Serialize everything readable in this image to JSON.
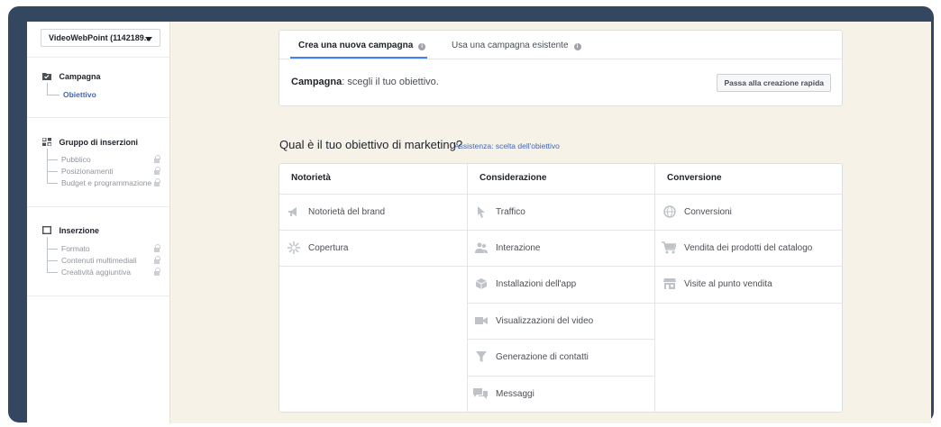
{
  "sidebar": {
    "account_label": "VideoWebPoint (1142189...",
    "sections": [
      {
        "title": "Campagna",
        "icon": "folder-check-icon",
        "items": [
          {
            "label": "Obiettivo",
            "active": true,
            "locked": false
          }
        ]
      },
      {
        "title": "Gruppo di inserzioni",
        "icon": "grid-icon",
        "items": [
          {
            "label": "Pubblico",
            "locked": true
          },
          {
            "label": "Posizionamenti",
            "locked": true
          },
          {
            "label": "Budget e programmazione",
            "locked": true
          }
        ]
      },
      {
        "title": "Inserzione",
        "icon": "square-icon",
        "items": [
          {
            "label": "Formato",
            "locked": true
          },
          {
            "label": "Contenuti multimediali",
            "locked": true
          },
          {
            "label": "Creatività aggiuntiva",
            "locked": true
          }
        ]
      }
    ]
  },
  "header": {
    "tabs": [
      {
        "label": "Crea una nuova campagna",
        "active": true
      },
      {
        "label": "Usa una campagna esistente",
        "active": false
      }
    ],
    "campaign_bold": "Campagna",
    "campaign_rest": ": scegli il tuo obiettivo.",
    "quick_button": "Passa alla creazione rapida"
  },
  "objectives": {
    "question": "Qual è il tuo obiettivo di marketing?",
    "assist_link": "Assistenza: scelta dell'obiettivo",
    "columns": [
      {
        "title": "Notorietà",
        "items": [
          {
            "label": "Notorietà del brand",
            "icon": "megaphone-icon"
          },
          {
            "label": "Copertura",
            "icon": "burst-icon"
          }
        ]
      },
      {
        "title": "Considerazione",
        "items": [
          {
            "label": "Traffico",
            "icon": "cursor-icon"
          },
          {
            "label": "Interazione",
            "icon": "people-icon"
          },
          {
            "label": "Installazioni dell'app",
            "icon": "box-icon"
          },
          {
            "label": "Visualizzazioni del video",
            "icon": "video-camera-icon"
          },
          {
            "label": "Generazione di contatti",
            "icon": "funnel-icon"
          },
          {
            "label": "Messaggi",
            "icon": "chat-bubbles-icon"
          }
        ]
      },
      {
        "title": "Conversione",
        "items": [
          {
            "label": "Conversioni",
            "icon": "globe-icon"
          },
          {
            "label": "Vendita dei prodotti del catalogo",
            "icon": "cart-icon"
          },
          {
            "label": "Visite al punto vendita",
            "icon": "store-icon"
          }
        ]
      }
    ]
  },
  "colors": {
    "frame": "#344761",
    "background": "#f6f2e7",
    "accent": "#4080ff",
    "link": "#4267b2"
  }
}
